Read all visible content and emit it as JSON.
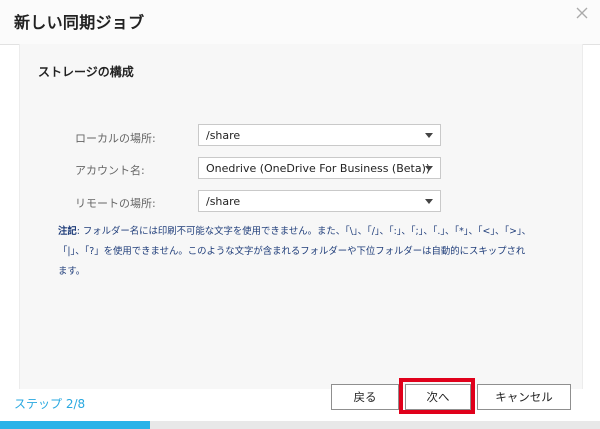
{
  "dialog": {
    "title": "新しい同期ジョブ"
  },
  "section": {
    "title": "ストレージの構成"
  },
  "fields": {
    "local": {
      "label": "ローカルの場所:",
      "value": "/share"
    },
    "account": {
      "label": "アカウント名:",
      "value": "Onedrive (OneDrive For Business (Beta))"
    },
    "remote": {
      "label": "リモートの場所:",
      "value": "/share"
    }
  },
  "note": {
    "label": "注記",
    "line1": ": フォルダー名には印刷不可能な文字を使用できません。また、「\\」、「/」、「:」、「;」、「.」、「*」、「<」、「>」、",
    "line2": "「|」、「?」を使用できません。このような文字が含まれるフォルダーや下位フォルダーは自動的にスキップされ",
    "line3": "ます。"
  },
  "footer": {
    "step_label": "ステップ ",
    "step_value": "2/8",
    "back_label": "戻る",
    "next_label": "次へ",
    "cancel_label": "キャンセル"
  },
  "progress": {
    "fraction": 0.25,
    "color": "#29b3e8"
  },
  "colors": {
    "accent": "#29a8e0",
    "highlight": "#e0001b",
    "note_text": "#1f3d7a"
  },
  "icons": {
    "close": "close-icon",
    "dropdown": "caret-down-icon"
  }
}
